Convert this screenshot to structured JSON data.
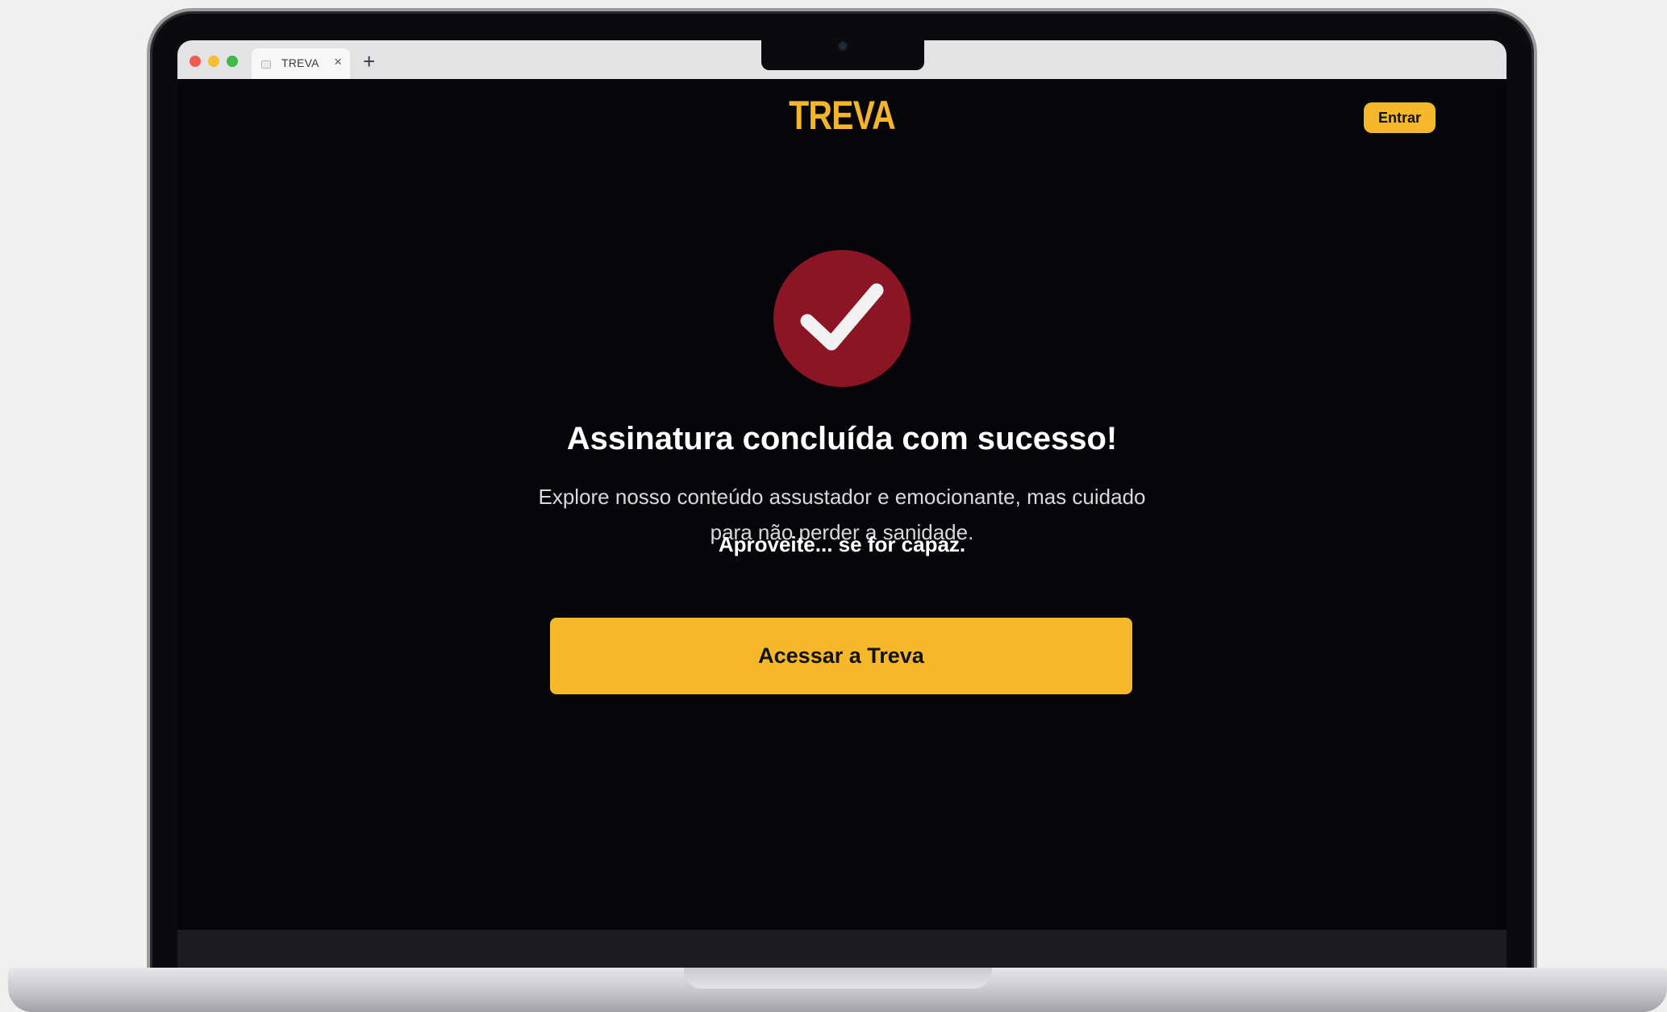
{
  "browser": {
    "tab_title": "TREVA",
    "tab_close": "×",
    "new_tab": "+"
  },
  "header": {
    "logo": "TREVA",
    "login_label": "Entrar"
  },
  "success": {
    "title": "Assinatura concluída com sucesso!",
    "description": "Explore nosso conteúdo assustador e emocionante, mas cuidado para não perder a sanidade.",
    "tagline": "Aproveite... se for capaz.",
    "cta_label": "Acessar a Treva"
  },
  "icons": {
    "success": "check-icon"
  },
  "colors": {
    "accent": "#f5b82a",
    "badge": "#8b1524",
    "background": "#05050a"
  }
}
